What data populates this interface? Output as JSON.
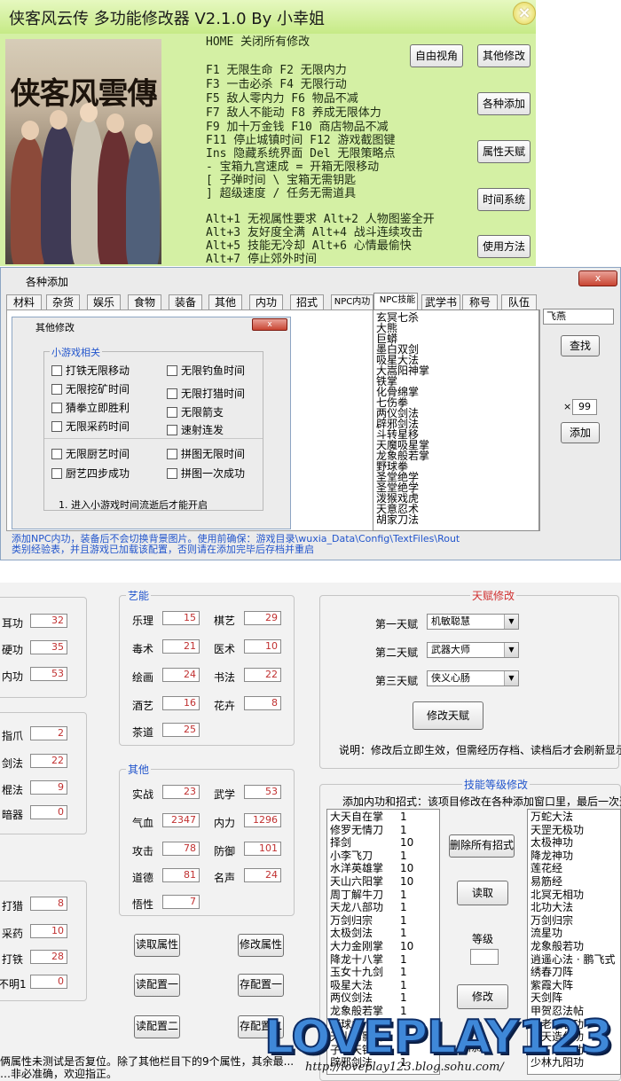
{
  "trainer": {
    "title": "侠客风云传 多功能修改器 V2.1.0 By 小幸姐",
    "close_icon": "×",
    "cover_title": "侠客风雲傳",
    "hotkeys": [
      "HOME   关闭所有修改",
      "F1   无限生命     F2   无限内力",
      "F3   一击必杀     F4   无限行动",
      "F5   敌人零内力   F6   物品不减",
      "F7   敌人不能动   F8   养成无限体力",
      "F9   加十万金钱   F10  商店物品不减",
      "F11  停止城镇时间 F12  游戏截图键",
      "Ins  隐藏系统界面 Del  无限策略点",
      " -   宝箱九宫速成  =   开箱无限移动",
      " [   子弹时间      \\   宝箱无需钥匙",
      " ]   超级速度      /   任务无需道具",
      "Alt+1 无视属性要求 Alt+2 人物图鉴全开",
      "Alt+3 友好度全满   Alt+4 战斗连续攻击",
      "Alt+5 技能无冷却   Alt+6 心情最偷快",
      "Alt+7 停止郊外时间"
    ],
    "buttons": [
      "自由视角",
      "其他修改",
      "各种添加",
      "属性天赋",
      "时间系统",
      "使用方法"
    ]
  },
  "addwin": {
    "title": "各种添加",
    "close_label": "x",
    "tabs": [
      "材料",
      "杂货",
      "娱乐",
      "食物",
      "装备",
      "其他",
      "内功",
      "招式",
      "NPC内功",
      "NPC技能",
      "武学书",
      "称号",
      "队伍"
    ],
    "selected_tab": "NPC技能",
    "npc_list": [
      "玄冥七杀",
      "大熊",
      "巨蟒",
      "墨白双剑",
      "吸星大法",
      "大嵩阳神掌",
      "铁掌",
      "化骨绵掌",
      "七伤拳",
      "两仪剑法",
      "辟邪剑法",
      "斗转星移",
      "天魔吸星掌",
      "龙象般若掌",
      "野球拳",
      "圣堂绝学",
      "圣堂绝学",
      "泼猴戏虎",
      "天意忍术",
      "胡家刀法"
    ],
    "search_value": "飞燕",
    "search_button": "查找",
    "times_sign": "×",
    "quantity": "99",
    "add_button": "添加",
    "note_lines": [
      "添加NPC内功，装备后不会切换背景图片。使用前确保：游戏目录\\wuxia_Data\\Config\\TextFiles\\Rout",
      "类别经验表，并且游戏已加载该配置，否则请在添加完毕后存档并重启"
    ]
  },
  "otherdlg": {
    "title": "其他修改",
    "close_label": "x",
    "group_label": "小游戏相关",
    "checkboxes": [
      "打铁无限移动",
      "无限钓鱼时间",
      "无限挖矿时间",
      "无限打猎时间",
      "猜拳立即胜利",
      "无限箭支",
      "无限采药时间",
      "速射连发",
      "无限厨艺时间",
      "拼图无限时间",
      "厨艺四步成功",
      "拼图一次成功"
    ],
    "note": "1. 进入小游戏时间流逝后才能开启"
  },
  "attributes": {
    "left_fields": [
      {
        "label": "耳功",
        "value": "32"
      },
      {
        "label": "硬功",
        "value": "35"
      },
      {
        "label": "内功",
        "value": "53"
      },
      {
        "label": "指爪",
        "value": "2"
      },
      {
        "label": "剑法",
        "value": "22"
      },
      {
        "label": "棍法",
        "value": "9"
      },
      {
        "label": "暗器",
        "value": "0"
      },
      {
        "label": "打猎",
        "value": "8"
      },
      {
        "label": "采药",
        "value": "10"
      },
      {
        "label": "打铁",
        "value": "28"
      },
      {
        "label": "不明1",
        "value": "0"
      }
    ],
    "arts_label": "艺能",
    "arts": [
      {
        "label": "乐理",
        "value": "15"
      },
      {
        "label": "棋艺",
        "value": "29"
      },
      {
        "label": "毒术",
        "value": "21"
      },
      {
        "label": "医术",
        "value": "10"
      },
      {
        "label": "绘画",
        "value": "24"
      },
      {
        "label": "书法",
        "value": "22"
      },
      {
        "label": "酒艺",
        "value": "16"
      },
      {
        "label": "花卉",
        "value": "8"
      },
      {
        "label": "茶道",
        "value": "25"
      }
    ],
    "other_label": "其他",
    "other": [
      {
        "label": "实战",
        "value": "23"
      },
      {
        "label": "武学",
        "value": "53"
      },
      {
        "label": "气血",
        "value": "2347"
      },
      {
        "label": "内力",
        "value": "1296"
      },
      {
        "label": "攻击",
        "value": "78"
      },
      {
        "label": "防御",
        "value": "101"
      },
      {
        "label": "道德",
        "value": "81"
      },
      {
        "label": "名声",
        "value": "24"
      },
      {
        "label": "悟性",
        "value": "7"
      }
    ],
    "buttons": [
      "读取属性",
      "修改属性",
      "读配置一",
      "存配置一",
      "读配置二",
      "存配置二"
    ]
  },
  "talent": {
    "label": "天赋修改",
    "rows": [
      {
        "label": "第一天赋",
        "value": "机敏聪慧"
      },
      {
        "label": "第二天赋",
        "value": "武器大师"
      },
      {
        "label": "第三天赋",
        "value": "侠义心肠"
      }
    ],
    "button": "修改天赋",
    "note": "说明：修改后立即生效，但需经历存档、读档后才会刷新显示"
  },
  "skills": {
    "label": "技能等级修改",
    "desc": "添加内功和招式：该项目修改在各种添加窗口里，最后一次选中",
    "list": [
      [
        "大天自在掌",
        "1"
      ],
      [
        "修罗无情刀",
        "1"
      ],
      [
        "择剑",
        "10"
      ],
      [
        "小李飞刀",
        "1"
      ],
      [
        "水洋英雄掌",
        "10"
      ],
      [
        "天山六阳掌",
        "10"
      ],
      [
        "周丁解牛刀",
        "1"
      ],
      [
        "天龙八部功",
        "1"
      ],
      [
        "万剑归宗",
        "1"
      ],
      [
        "太极剑法",
        "1"
      ],
      [
        "大力金刚掌",
        "10"
      ],
      [
        "降龙十八掌",
        "1"
      ],
      [
        "玉女十九剑",
        "1"
      ],
      [
        "吸星大法",
        "1"
      ],
      [
        "两仪剑法",
        "1"
      ],
      [
        "龙象般若掌",
        "1"
      ],
      [
        "野球拳",
        "1"
      ],
      [
        "天山幻影剑",
        "1"
      ],
      [
        "子母天钩",
        "1"
      ],
      [
        "辟邪剑法",
        "1"
      ]
    ],
    "right_list": [
      "万蛇大法",
      "天罡无极功",
      "太极神功",
      "降龙神功",
      "莲花经",
      "易筋经",
      "北冥无相功",
      "北功大法",
      "万剑归宗",
      "流星功",
      "龙象般若功",
      "逍遥心法 · 鹏飞式",
      "绣春刀阵",
      "紫霞大阵",
      "天剑阵",
      "甲贺忍法帖",
      "不老长春功",
      "梵天造化功",
      "周丁解牛功",
      "少林九阳功"
    ],
    "delete_button": "删除所有招式",
    "read_button": "读取",
    "level_label": "等级",
    "level_value": "",
    "modify_button": "修改",
    "extra_button": "删除所"
  },
  "watermark": {
    "text": "LOVEPLAY123",
    "url": "http://loveplay123.blog.sohu.com/"
  },
  "bottom_note": [
    "俩属性未测试是否复位。除了其他栏目下的9个属性，其余最...",
    "…非必准确，欢迎指正。"
  ]
}
